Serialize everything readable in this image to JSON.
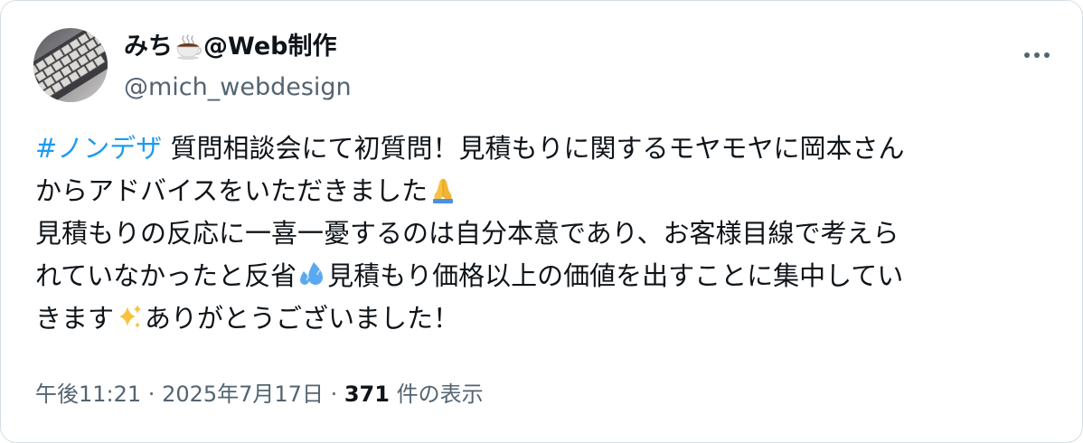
{
  "author": {
    "name_prefix": "みち",
    "name_suffix": "@Web制作",
    "handle": "@mich_webdesign",
    "avatar_icon": "laptop-keyboard-avatar",
    "name_emoji_icon": "hot-beverage-icon"
  },
  "menu": {
    "icon": "more-options-icon"
  },
  "tweet": {
    "hashtag": "#ノンデザ",
    "line1_text": " 質問相談会にて初質問！見積もりに関するモヤモヤに岡本さん",
    "line2_text": "からアドバイスをいただきました",
    "line2_emoji_icon": "folded-hands-icon",
    "line3_text": "見積もりの反応に一喜一憂するのは自分本意であり、お客様目線で考えら",
    "line4_text_a": "れていなかったと反省",
    "line4_emoji_icon": "sweat-droplets-icon",
    "line4_text_b": "見積もり価格以上の価値を出すことに集中してい",
    "line5_text_a": "きます",
    "line5_emoji_icon": "sparkles-icon",
    "line5_text_b": "ありがとうございました！"
  },
  "meta": {
    "time": "午後11:21",
    "separator_1": " · ",
    "date": "2025年7月17日",
    "separator_2": " · ",
    "views_count": "371",
    "views_label": " 件の表示"
  },
  "colors": {
    "text": "#0f1419",
    "secondary": "#536471",
    "link": "#1d9bf0",
    "border": "#d6dde3"
  }
}
